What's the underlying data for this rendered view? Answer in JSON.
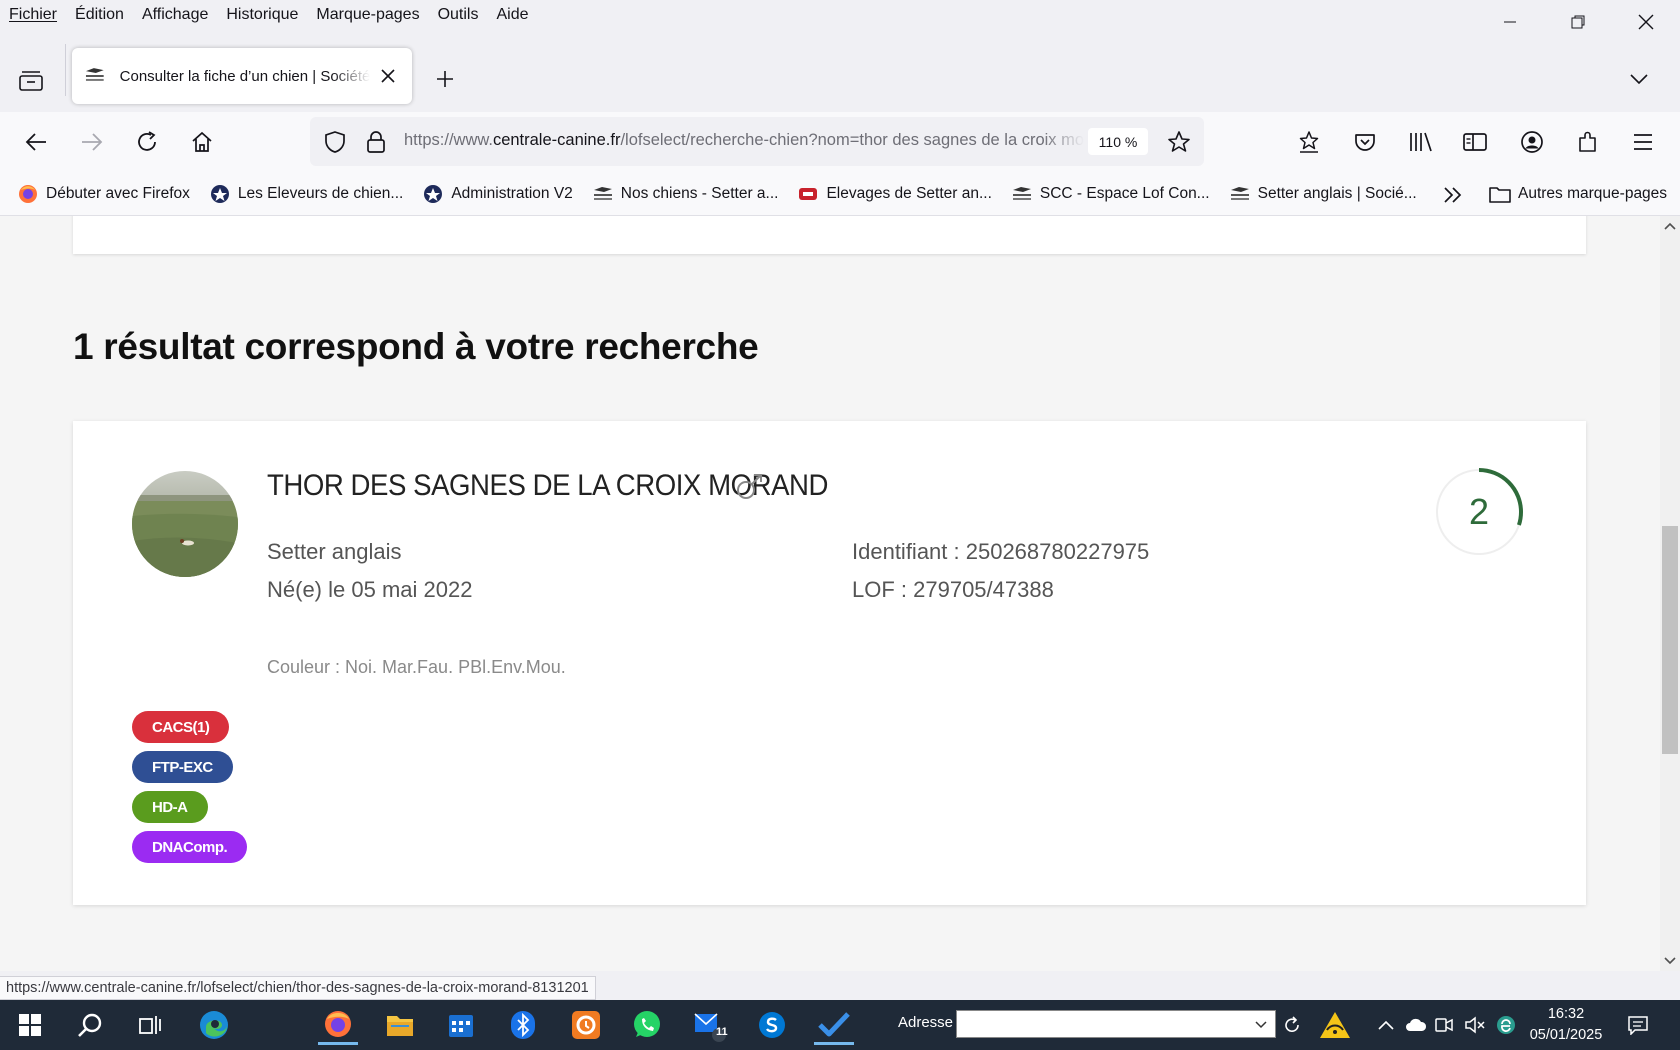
{
  "menubar": {
    "items": [
      "Fichier",
      "Édition",
      "Affichage",
      "Historique",
      "Marque-pages",
      "Outils",
      "Aide"
    ]
  },
  "tab": {
    "title": "Consulter la fiche d’un chien | Société Centrale Canine"
  },
  "navbar": {
    "url_prefix": "https://www.",
    "url_domain": "centrale-canine.fr",
    "url_path": "/lofselect/recherche-chien?nom=thor des sagnes de la croix morand",
    "zoom": "110 %"
  },
  "bookmarks": {
    "items": [
      {
        "label": "Débuter avec Firefox",
        "icon": "firefox-icon"
      },
      {
        "label": "Les Eleveurs de chien...",
        "icon": "badge-icon"
      },
      {
        "label": "Administration V2",
        "icon": "badge-icon"
      },
      {
        "label": "Nos chiens - Setter a...",
        "icon": "centrale-canine-icon"
      },
      {
        "label": "Elevages de Setter an...",
        "icon": "red-logo-icon"
      },
      {
        "label": "SCC - Espace Lof Con...",
        "icon": "centrale-canine-icon"
      },
      {
        "label": "Setter anglais | Socié...",
        "icon": "centrale-canine-icon"
      }
    ],
    "other": "Autres marque-pages"
  },
  "page": {
    "heading": "1 résultat correspond à votre recherche",
    "dog": {
      "name": "THOR DES SAGNES DE LA CROIX MORAND",
      "sex_symbol": "♂",
      "breed": "Setter anglais",
      "birth": "Né(e) le 05 mai 2022",
      "identifier": "Identifiant : 250268780227975",
      "lof": "LOF : 279705/47388",
      "color": "Couleur : Noi. Mar.Fau. PBl.Env.Mou.",
      "score": "2",
      "score_fraction": 0.3,
      "badges": [
        {
          "label": "CACS(1)",
          "color": "#d9303c"
        },
        {
          "label": "FTP-EXC",
          "color": "#2f4f94"
        },
        {
          "label": "HD-A",
          "color": "#5a9c1e"
        },
        {
          "label": "DNAComp.",
          "color": "#9b2bf2"
        }
      ]
    }
  },
  "status_link": "https://www.centrale-canine.fr/lofselect/chien/thor-des-sagnes-de-la-croix-morand-8131201",
  "taskbar": {
    "address_label": "Adresse",
    "badge_count": "11",
    "time": "16:32",
    "date": "05/01/2025"
  }
}
